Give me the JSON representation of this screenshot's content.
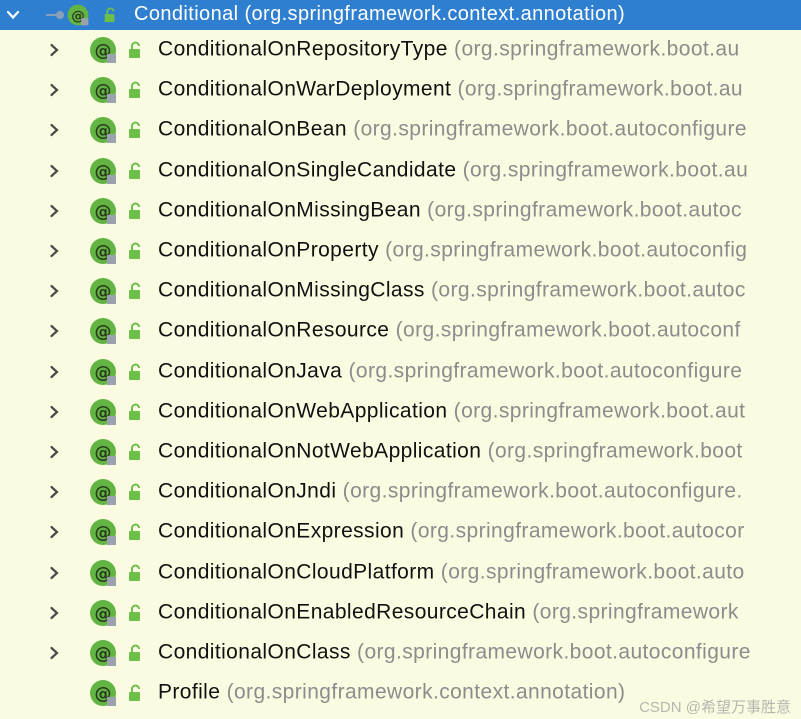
{
  "root": {
    "name": "Conditional",
    "package": "(org.springframework.context.annotation)"
  },
  "children": [
    {
      "name": "ConditionalOnRepositoryType",
      "package": "(org.springframework.boot.au"
    },
    {
      "name": "ConditionalOnWarDeployment",
      "package": "(org.springframework.boot.au"
    },
    {
      "name": "ConditionalOnBean",
      "package": "(org.springframework.boot.autoconfigure"
    },
    {
      "name": "ConditionalOnSingleCandidate",
      "package": "(org.springframework.boot.au"
    },
    {
      "name": "ConditionalOnMissingBean",
      "package": "(org.springframework.boot.autoc"
    },
    {
      "name": "ConditionalOnProperty",
      "package": "(org.springframework.boot.autoconfig"
    },
    {
      "name": "ConditionalOnMissingClass",
      "package": "(org.springframework.boot.autoc"
    },
    {
      "name": "ConditionalOnResource",
      "package": "(org.springframework.boot.autoconf"
    },
    {
      "name": "ConditionalOnJava",
      "package": "(org.springframework.boot.autoconfigure"
    },
    {
      "name": "ConditionalOnWebApplication",
      "package": "(org.springframework.boot.aut"
    },
    {
      "name": "ConditionalOnNotWebApplication",
      "package": "(org.springframework.boot"
    },
    {
      "name": "ConditionalOnJndi",
      "package": "(org.springframework.boot.autoconfigure."
    },
    {
      "name": "ConditionalOnExpression",
      "package": "(org.springframework.boot.autocor"
    },
    {
      "name": "ConditionalOnCloudPlatform",
      "package": "(org.springframework.boot.auto"
    },
    {
      "name": "ConditionalOnEnabledResourceChain",
      "package": "(org.springframework"
    },
    {
      "name": "ConditionalOnClass",
      "package": "(org.springframework.boot.autoconfigure"
    },
    {
      "name": "Profile",
      "package": "(org.springframework.context.annotation)",
      "expandable": false
    }
  ],
  "watermark": "CSDN @希望万事胜意",
  "colors": {
    "background": "#fbfbe2",
    "selection": "#2f7fd0",
    "annotation_icon": "#62b543",
    "package_text": "#8c8c8c"
  },
  "icons": {
    "expand": "chevron-right-icon",
    "collapse": "chevron-down-icon",
    "annotation": "annotation-at-icon",
    "access": "unlocked-icon"
  }
}
